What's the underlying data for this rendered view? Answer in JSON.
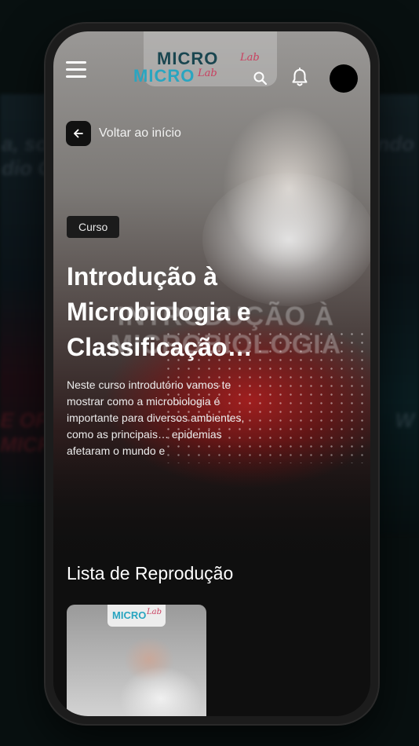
{
  "background": {
    "left_text_top": "a, sol\ndio Co",
    "right_text_top": "ando\ns",
    "left_text_bottom": "E OF\nMICR",
    "right_text_bottom": "W"
  },
  "logo": {
    "primary": "MICRO",
    "secondary": "MICRO",
    "lab_primary": "Lab",
    "lab_secondary": "Lab"
  },
  "header": {
    "menu_icon": "hamburger-icon",
    "search_icon": "search-icon",
    "notification_icon": "bell-icon"
  },
  "nav": {
    "back_label": "Voltar ao início"
  },
  "hero": {
    "badge": "Curso",
    "title": "Introdução à Microbiologia e Classificação…",
    "watermark": "INTRODUÇÃO À MICROBIOLOGIA",
    "description": "Neste curso introdutório vamos te mostrar como a microbiologia é importante para diversos ambientes, como as principais… epidemias afetaram o mundo e"
  },
  "playlist": {
    "title": "Lista de Reprodução",
    "thumbnail_logo": "MICRO",
    "thumbnail_lab": "Lab"
  },
  "colors": {
    "accent_cyan": "#2aa5c0",
    "accent_pink": "#c94060",
    "background": "#0f0f0f"
  }
}
